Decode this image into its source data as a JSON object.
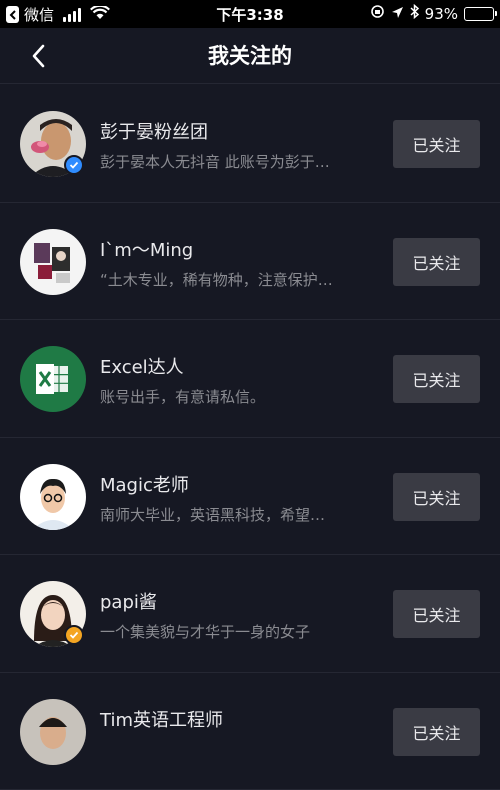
{
  "status_bar": {
    "back_app": "微信",
    "time": "下午3:38",
    "battery": "93%",
    "battery_level": 0.93
  },
  "nav": {
    "title": "我关注的"
  },
  "follow_label": "已关注",
  "users": [
    {
      "name": "彭于晏粉丝团",
      "desc": "彭于晏本人无抖音 此账号为彭于…",
      "badge": "verified-blue",
      "badge_color": "#2f8cff"
    },
    {
      "name": "I`m～Ming",
      "desc": "“土木专业，稀有物种，注意保护…",
      "badge": "",
      "badge_color": ""
    },
    {
      "name": "Excel达人",
      "desc": "账号出手，有意请私信。",
      "badge": "",
      "badge_color": ""
    },
    {
      "name": "Magic老师",
      "desc": "南师大毕业，英语黑科技，希望…",
      "badge": "",
      "badge_color": ""
    },
    {
      "name": "papi酱",
      "desc": "一个集美貌与才华于一身的女子",
      "badge": "verified-orange",
      "badge_color": "#f4a522"
    },
    {
      "name": "Tim英语工程师",
      "desc": "",
      "badge": "",
      "badge_color": ""
    }
  ]
}
